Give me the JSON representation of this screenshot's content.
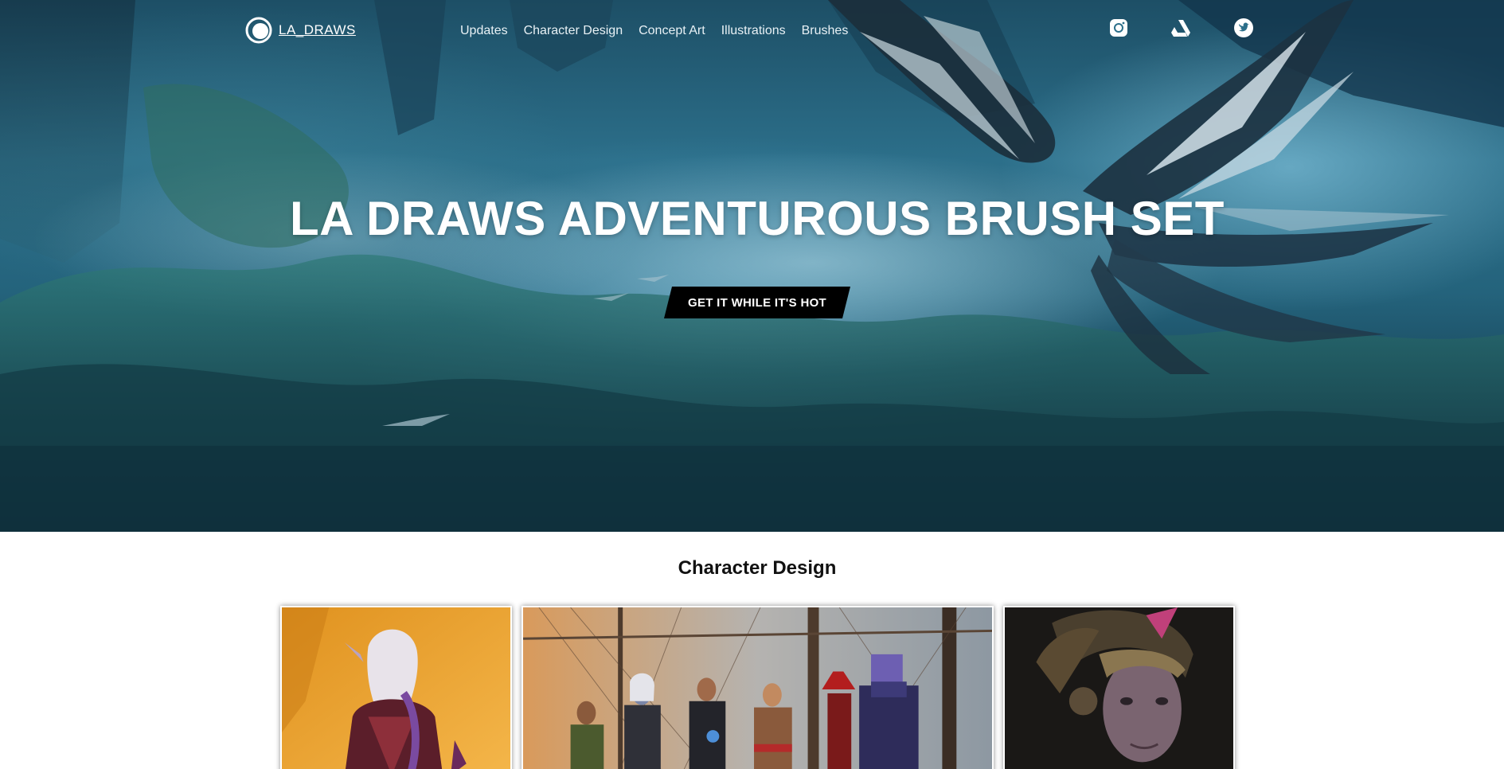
{
  "brand": {
    "name": "LA_DRAWS"
  },
  "nav": {
    "items": [
      {
        "label": "Updates"
      },
      {
        "label": "Character Design"
      },
      {
        "label": "Concept Art"
      },
      {
        "label": "Illustrations"
      },
      {
        "label": "Brushes"
      }
    ]
  },
  "social": [
    {
      "icon": "instagram-icon"
    },
    {
      "icon": "artstation-icon"
    },
    {
      "icon": "twitter-icon"
    }
  ],
  "hero": {
    "title": "LA DRAWS ADVENTUROUS BRUSH SET",
    "cta_label": "GET IT WHILE IT'S HOT"
  },
  "section": {
    "title": "Character Design",
    "cards": [
      {
        "subject": "elf-warrior-portrait"
      },
      {
        "subject": "pirate-crew-group"
      },
      {
        "subject": "horned-woman-portrait"
      }
    ]
  },
  "colors": {
    "hero_teal": "#2c6f8a",
    "cta_bg": "#000000",
    "text_white": "#ffffff"
  }
}
